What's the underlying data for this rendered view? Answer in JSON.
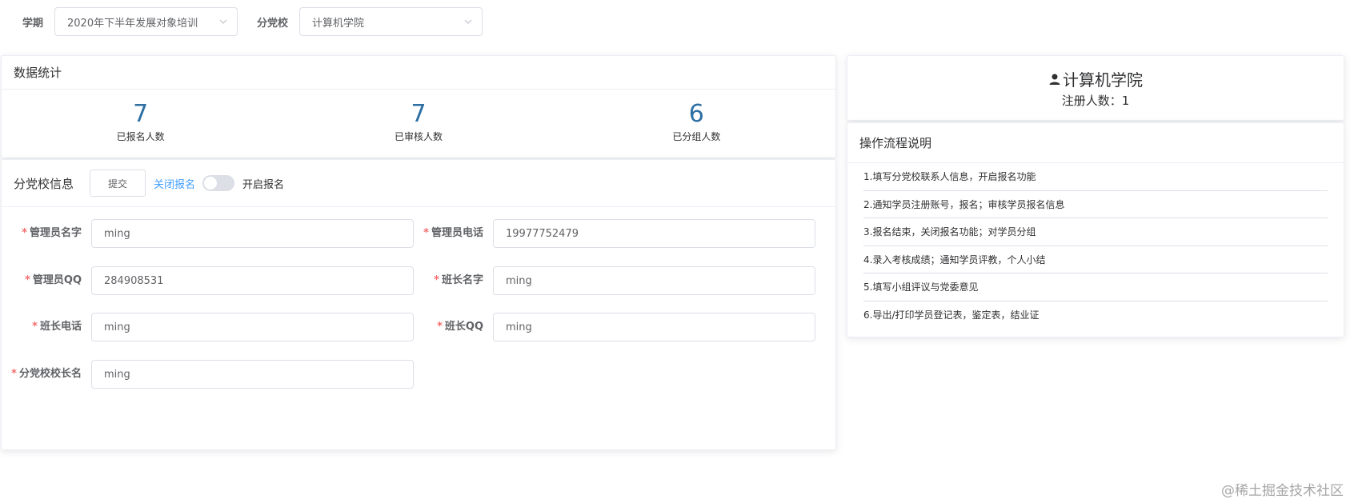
{
  "filters": {
    "term_label": "学期",
    "term_value": "2020年下半年发展对象培训",
    "branch_label": "分党校",
    "branch_value": "计算机学院"
  },
  "stats": {
    "title": "数据统计",
    "items": [
      {
        "value": "7",
        "label": "已报名人数"
      },
      {
        "value": "7",
        "label": "已审核人数"
      },
      {
        "value": "6",
        "label": "已分组人数"
      }
    ]
  },
  "branch_info": {
    "title": "分党校信息",
    "submit_label": "提交",
    "close_label": "关闭报名",
    "open_label": "开启报名",
    "registration_open": false,
    "fields": [
      {
        "label": "管理员名字",
        "value": "ming"
      },
      {
        "label": "管理员电话",
        "value": "19977752479"
      },
      {
        "label": "管理员QQ",
        "value": "284908531"
      },
      {
        "label": "班长名字",
        "value": "ming"
      },
      {
        "label": "班长电话",
        "value": "ming"
      },
      {
        "label": "班长QQ",
        "value": "ming"
      },
      {
        "label": "分党校校长名",
        "value": "ming"
      }
    ],
    "required_mark": "*"
  },
  "user": {
    "title": "计算机学院",
    "registered_text": "注册人数：1"
  },
  "flow": {
    "title": "操作流程说明",
    "items": [
      "1.填写分党校联系人信息，开启报名功能",
      "2.通知学员注册账号，报名；审核学员报名信息",
      "3.报名结束，关闭报名功能；对学员分组",
      "4.录入考核成绩；通知学员评教，个人小结",
      "5.填写小组评议与党委意见",
      "6.导出/打印学员登记表，鉴定表，结业证"
    ]
  },
  "watermark": "@稀土掘金技术社区",
  "colors": {
    "accent_blue": "#409eff",
    "stat_number": "#2d6fa3",
    "required_red": "#f56c6c"
  }
}
